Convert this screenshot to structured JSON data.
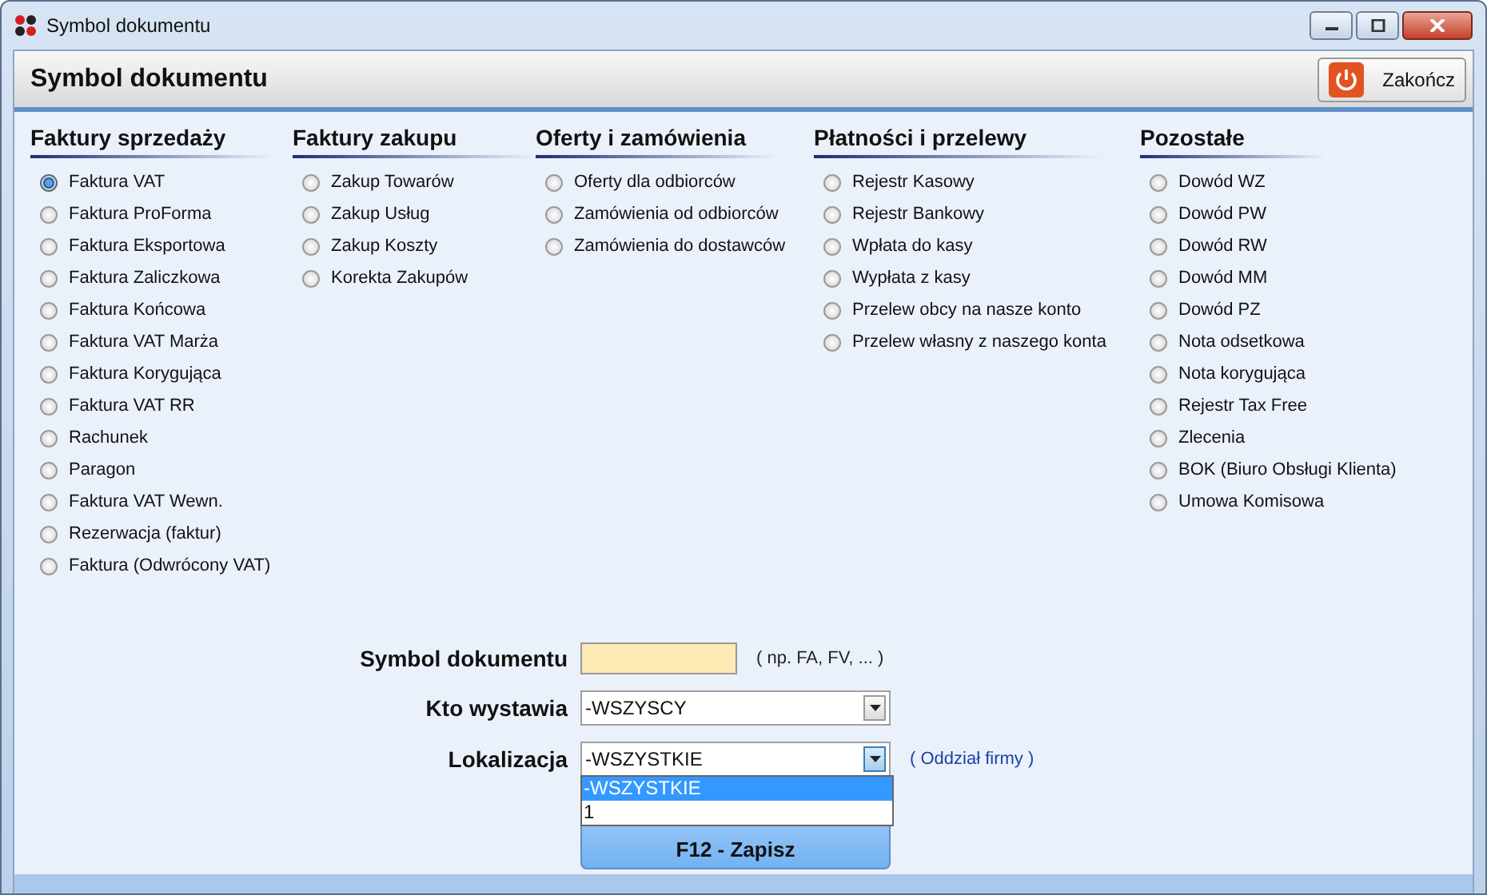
{
  "window": {
    "title": "Symbol dokumentu"
  },
  "header": {
    "title": "Symbol dokumentu",
    "close_button": "Zakończ"
  },
  "groups": [
    {
      "title": "Faktury sprzedaży",
      "options": [
        {
          "label": "Faktura VAT",
          "selected": true
        },
        {
          "label": "Faktura ProForma",
          "selected": false
        },
        {
          "label": "Faktura Eksportowa",
          "selected": false
        },
        {
          "label": "Faktura Zaliczkowa",
          "selected": false
        },
        {
          "label": "Faktura Końcowa",
          "selected": false
        },
        {
          "label": "Faktura VAT Marża",
          "selected": false
        },
        {
          "label": "Faktura Korygująca",
          "selected": false
        },
        {
          "label": "Faktura VAT RR",
          "selected": false
        },
        {
          "label": "Rachunek",
          "selected": false
        },
        {
          "label": "Paragon",
          "selected": false
        },
        {
          "label": "Faktura VAT Wewn.",
          "selected": false
        },
        {
          "label": "Rezerwacja (faktur)",
          "selected": false
        },
        {
          "label": "Faktura (Odwrócony VAT)",
          "selected": false
        }
      ]
    },
    {
      "title": "Faktury zakupu",
      "options": [
        {
          "label": "Zakup Towarów",
          "selected": false
        },
        {
          "label": "Zakup Usług",
          "selected": false
        },
        {
          "label": "Zakup Koszty",
          "selected": false
        },
        {
          "label": "Korekta Zakupów",
          "selected": false
        }
      ]
    },
    {
      "title": "Oferty i zamówienia",
      "options": [
        {
          "label": "Oferty dla odbiorców",
          "selected": false
        },
        {
          "label": "Zamówienia od odbiorców",
          "selected": false
        },
        {
          "label": "Zamówienia do dostawców",
          "selected": false
        }
      ]
    },
    {
      "title": "Płatności i przelewy",
      "options": [
        {
          "label": "Rejestr Kasowy",
          "selected": false
        },
        {
          "label": "Rejestr Bankowy",
          "selected": false
        },
        {
          "label": "Wpłata do kasy",
          "selected": false
        },
        {
          "label": "Wypłata z kasy",
          "selected": false
        },
        {
          "label": "Przelew obcy na nasze konto",
          "selected": false
        },
        {
          "label": "Przelew własny z naszego konta",
          "selected": false
        }
      ]
    },
    {
      "title": "Pozostałe",
      "options": [
        {
          "label": "Dowód WZ",
          "selected": false
        },
        {
          "label": "Dowód PW",
          "selected": false
        },
        {
          "label": "Dowód RW",
          "selected": false
        },
        {
          "label": "Dowód MM",
          "selected": false
        },
        {
          "label": "Dowód PZ",
          "selected": false
        },
        {
          "label": "Nota odsetkowa",
          "selected": false
        },
        {
          "label": "Nota korygująca",
          "selected": false
        },
        {
          "label": "Rejestr Tax Free",
          "selected": false
        },
        {
          "label": "Zlecenia",
          "selected": false
        },
        {
          "label": "BOK (Biuro Obsługi Klienta)",
          "selected": false
        },
        {
          "label": "Umowa Komisowa",
          "selected": false
        }
      ]
    }
  ],
  "form": {
    "symbol": {
      "label": "Symbol dokumentu",
      "hint": "( np. FA, FV, ... )"
    },
    "issuer": {
      "label": "Kto wystawia",
      "value": "-WSZYSCY"
    },
    "location": {
      "label": "Lokalizacja",
      "value": "-WSZYSTKIE",
      "hint": "( Oddział firmy )",
      "expanded": true,
      "options": [
        {
          "label": "-WSZYSTKIE",
          "selected": true
        },
        {
          "label": "1",
          "selected": false
        }
      ]
    },
    "save_button": "F12 - Zapisz"
  }
}
